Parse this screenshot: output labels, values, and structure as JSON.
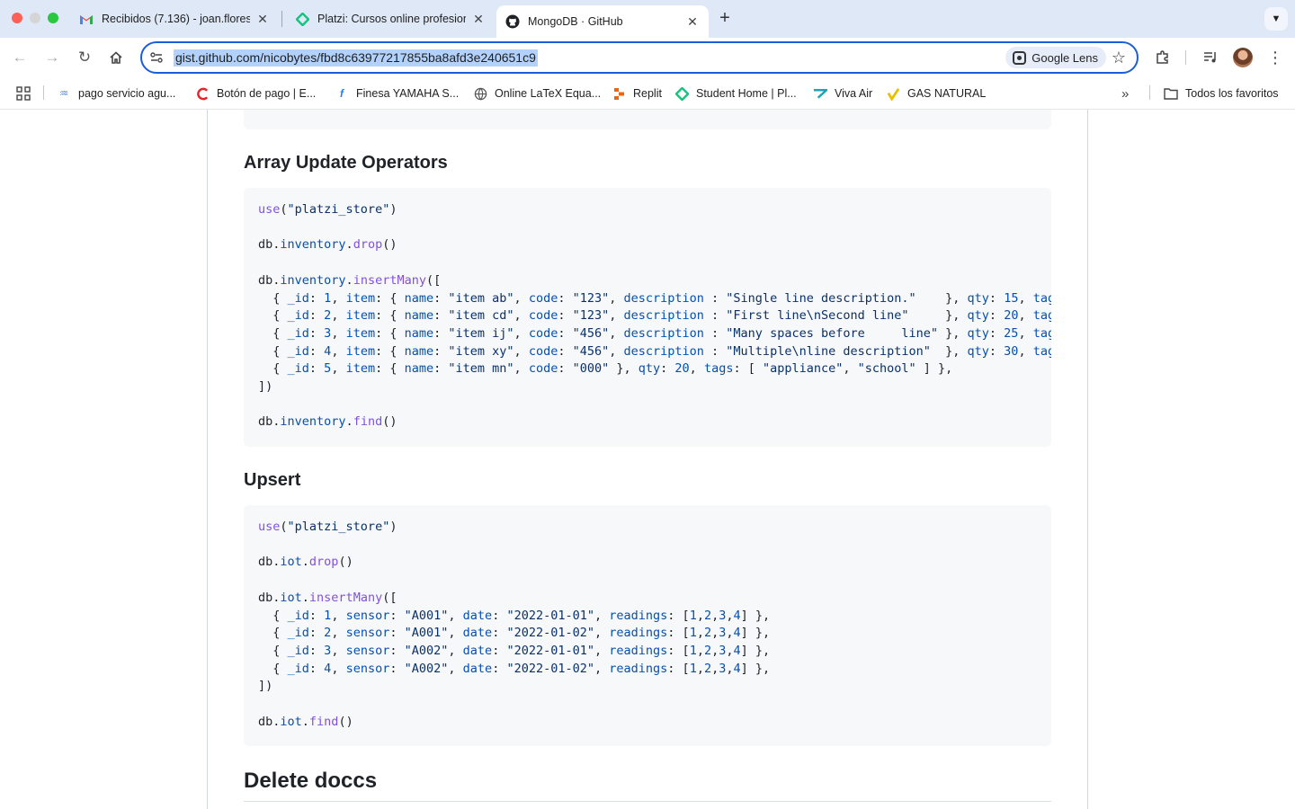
{
  "browser": {
    "tabs": [
      {
        "title": "Recibidos (7.136) - joan.flores",
        "icon": "gmail-icon"
      },
      {
        "title": "Platzi: Cursos online profesiona",
        "icon": "platzi-icon"
      },
      {
        "title": "MongoDB · GitHub",
        "icon": "github-icon",
        "active": true
      }
    ],
    "new_tab": "+",
    "url": "gist.github.com/nicobytes/fbd8c63977217855ba8afd3e240651c9",
    "lens_label": "Google Lens",
    "bookmarks": [
      {
        "label": "pago servicio agu...",
        "icon": "water-icon"
      },
      {
        "label": "Botón de pago | E...",
        "icon": "payment-icon"
      },
      {
        "label": "Finesa YAMAHA S...",
        "icon": "finesa-icon"
      },
      {
        "label": "Online LaTeX Equa...",
        "icon": "globe-icon"
      },
      {
        "label": "Replit",
        "icon": "replit-icon"
      },
      {
        "label": "Student Home | Pl...",
        "icon": "platzi-icon"
      },
      {
        "label": "Viva Air",
        "icon": "vivaair-icon"
      },
      {
        "label": "GAS NATURAL",
        "icon": "gas-icon"
      }
    ],
    "all_bookmarks": "Todos los favoritos"
  },
  "sections": {
    "array_update": "Array Update Operators",
    "upsert": "Upsert",
    "delete": "Delete doccs"
  },
  "colors": {
    "code_bg": "#f6f8fa",
    "function": "#8250df",
    "property": "#0550ae",
    "string": "#0a3069",
    "accent": "#1a5ed8"
  }
}
